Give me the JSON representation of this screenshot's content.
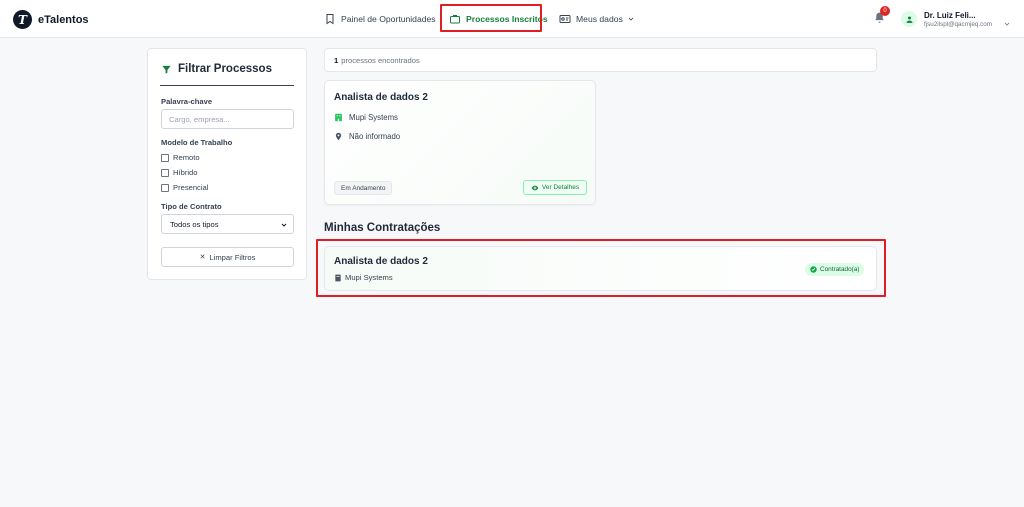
{
  "brand": {
    "logo_letter": "T",
    "name": "eTalentos"
  },
  "nav": {
    "items": [
      {
        "label": "Painel de Oportunidades",
        "icon": "bookmark-icon",
        "active": false
      },
      {
        "label": "Processos Inscritos",
        "icon": "briefcase-icon",
        "active": true
      },
      {
        "label": "Meus dados",
        "icon": "id-card-icon",
        "active": false,
        "has_dropdown": true
      }
    ]
  },
  "header": {
    "notifications_count": "0",
    "user_name": "Dr. Luiz Feli...",
    "user_email": "fjsu2ilspl@qacmjeq.com"
  },
  "filter": {
    "title": "Filtrar Processos",
    "keyword_label": "Palavra-chave",
    "keyword_placeholder": "Cargo, empresa...",
    "keyword_value": "",
    "work_model_label": "Modelo de Trabalho",
    "work_models": [
      "Remoto",
      "Híbrido",
      "Presencial"
    ],
    "contract_label": "Tipo de Contrato",
    "contract_selected": "Todos os tipos",
    "clear_label": "Limpar Filtros"
  },
  "results": {
    "count": "1",
    "count_suffix": "processos encontrados"
  },
  "process_card": {
    "title": "Analista de dados 2",
    "company": "Mupi Systems",
    "location": "Não informado",
    "status": "Em Andamento",
    "details_label": "Ver Detalhes"
  },
  "hires": {
    "section_title": "Minhas Contratações",
    "card": {
      "title": "Analista de dados 2",
      "company": "Mupi Systems",
      "badge": "Contratado(a)"
    }
  },
  "colors": {
    "accent_green": "#15803d",
    "highlight_red": "#e11d24",
    "badge_green_bg": "#dcfce7",
    "notification_red": "#dc2626"
  }
}
